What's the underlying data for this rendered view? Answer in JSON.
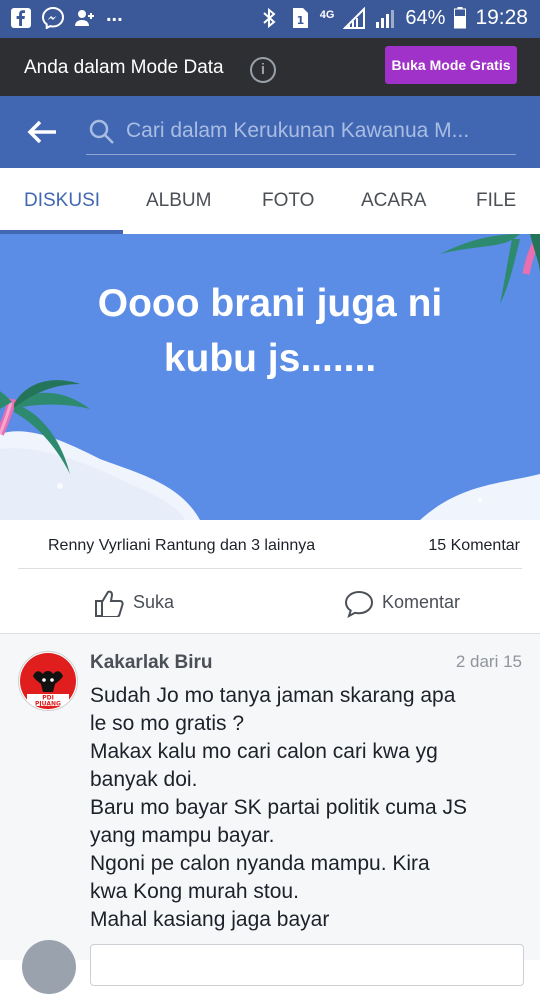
{
  "status_bar": {
    "network": "4G",
    "battery": "64%",
    "time": "19:28",
    "dots": "...",
    "icons": [
      "facebook-icon",
      "messenger-icon",
      "add-friend-icon",
      "bluetooth-icon",
      "sim1-icon",
      "signal-icon",
      "battery-icon"
    ]
  },
  "mode_bar": {
    "text": "Anda dalam Mode Data",
    "info": "i",
    "button": "Buka Mode Gratis",
    "button_color": "#a031c9"
  },
  "header": {
    "search_placeholder": "Cari dalam Kerukunan Kawanua M...",
    "color": "#4267b2"
  },
  "tabs": [
    {
      "label": "DISKUSI",
      "active": true
    },
    {
      "label": "ALBUM",
      "active": false
    },
    {
      "label": "FOTO",
      "active": false
    },
    {
      "label": "ACARA",
      "active": false
    },
    {
      "label": "FILE",
      "active": false
    }
  ],
  "post": {
    "line1": "Oooo brani juga ni",
    "line2": "kubu js.......",
    "background": "#5b8ce6"
  },
  "reactions": {
    "names": "Renny Vyrliani Rantung dan 3 lainnya",
    "comments": "15 Komentar"
  },
  "actions": {
    "like": "Suka",
    "comment": "Komentar"
  },
  "comment": {
    "author": "Kakarlak Biru",
    "position": "2 dari 15",
    "avatar_text": "PDI\nPJUANG",
    "lines": [
      "Sudah Jo mo tanya jaman skarang apa",
      "le so mo gratis ?",
      "Makax kalu mo cari calon cari kwa yg",
      "banyak doi.",
      "Baru mo bayar SK partai politik cuma JS",
      "yang mampu bayar.",
      "Ngoni pe calon nyanda mampu. Kira",
      "kwa Kong murah stou.",
      "Mahal kasiang jaga bayar"
    ]
  }
}
